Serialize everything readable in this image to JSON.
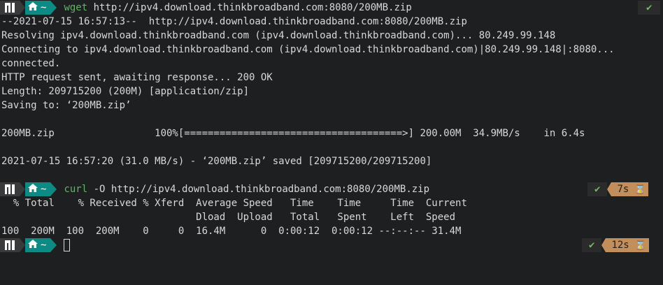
{
  "prompt": {
    "home_symbol": "~"
  },
  "commands": {
    "wget": {
      "name": "wget",
      "args": "http://ipv4.download.thinkbroadband.com:8080/200MB.zip"
    },
    "curl": {
      "name": "curl",
      "args": "-O http://ipv4.download.thinkbroadband.com:8080/200MB.zip"
    }
  },
  "status": {
    "check": "✔",
    "curl_time": "7s",
    "final_time": "12s"
  },
  "output": {
    "wget_lines": [
      "--2021-07-15 16:57:13--  http://ipv4.download.thinkbroadband.com:8080/200MB.zip",
      "Resolving ipv4.download.thinkbroadband.com (ipv4.download.thinkbroadband.com)... 80.249.99.148",
      "Connecting to ipv4.download.thinkbroadband.com (ipv4.download.thinkbroadband.com)|80.249.99.148|:8080...",
      "connected.",
      "HTTP request sent, awaiting response... 200 OK",
      "Length: 209715200 (200M) [application/zip]",
      "Saving to: ‘200MB.zip’",
      "200MB.zip                 100%[=====================================>] 200.00M  34.9MB/s    in 6.4s",
      "2021-07-15 16:57:20 (31.0 MB/s) - ‘200MB.zip’ saved [209715200/209715200]"
    ],
    "curl_lines": [
      "  % Total    % Received % Xferd  Average Speed   Time    Time     Time  Current",
      "                                 Dload  Upload   Total   Spent    Left  Speed",
      "100  200M  100  200M    0     0  16.4M      0  0:00:12  0:00:12 --:--:-- 31.4M"
    ]
  },
  "colors": {
    "background": "#1d1f21",
    "prompt_teal": "#0e8a84",
    "command_green": "#67b06b",
    "time_badge": "#c28f5c",
    "ok_green": "#6fbf5a"
  },
  "icons": [
    "manjaro-logo-icon",
    "home-icon",
    "check-icon",
    "hourglass-icon"
  ]
}
